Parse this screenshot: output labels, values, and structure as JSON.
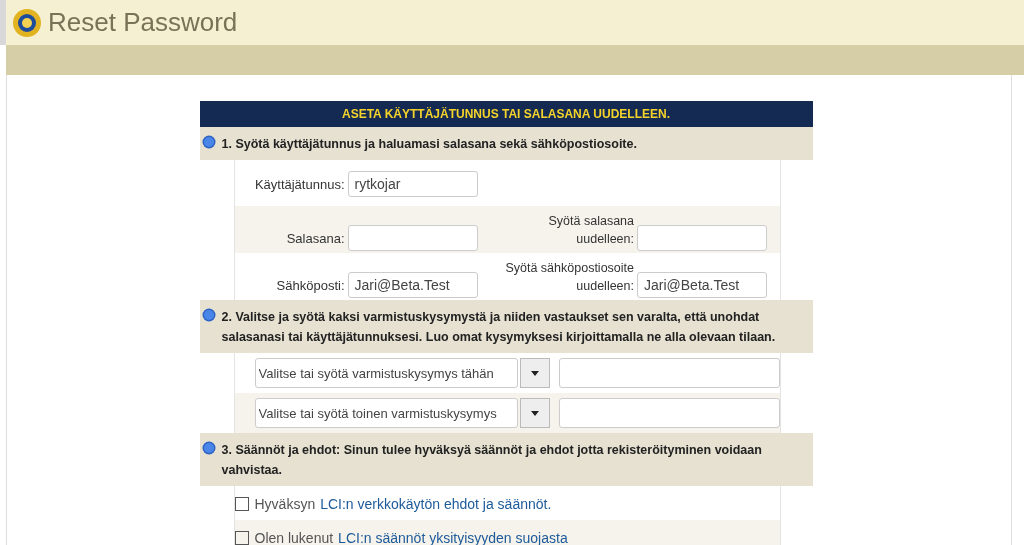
{
  "header": {
    "title": "Reset Password"
  },
  "form": {
    "title": "ASETA KÄYTTÄJÄTUNNUS TAI SALASANA UUDELLEEN.",
    "section_1": {
      "heading": "1. Syötä käyttäjätunnus ja haluamasi salasana sekä sähköpostiosoite.",
      "username": {
        "label": "Käyttäjätunnus:",
        "value": "rytkojar"
      },
      "password": {
        "label": "Salasana:"
      },
      "password_again": {
        "label": "Syötä salasana uudelleen:"
      },
      "email": {
        "label": "Sähköposti:",
        "value": "Jari@Beta.Test"
      },
      "email_again": {
        "label": "Syötä sähköpostiosoite uudelleen:",
        "value": "Jari@Beta.Test"
      }
    },
    "section_2": {
      "heading": "2. Valitse ja syötä kaksi varmistuskysymystä ja niiden vastaukset sen varalta, että unohdat salasanasi tai käyttäjätunnuksesi. Luo omat kysymyksesi kirjoittamalla ne alla olevaan tilaan.",
      "questions": [
        {
          "placeholder": "Valitse tai syötä varmistuskysymys tähän"
        },
        {
          "placeholder": "Valitse tai syötä toinen varmistuskysymys"
        }
      ]
    },
    "section_3": {
      "heading": "3. Säännöt ja ehdot: Sinun tulee hyväksyä säännöt ja ehdot jotta rekisteröityminen voidaan vahvistaa.",
      "agreements": [
        {
          "text": "Hyväksyn",
          "link": "LCI:n verkkokäytön ehdot ja säännöt.",
          "checked": false
        },
        {
          "text": "Olen lukenut",
          "link": "LCI:n säännöt yksityisyyden suojasta",
          "checked": false
        }
      ]
    }
  }
}
